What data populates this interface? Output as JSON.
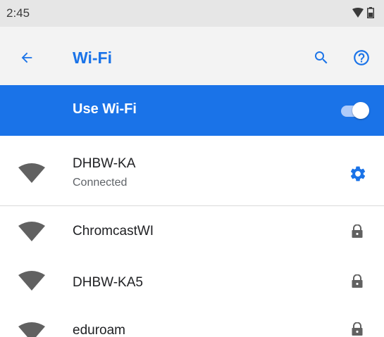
{
  "status_bar": {
    "time": "2:45",
    "icons": [
      "wifi-signal-icon",
      "battery-icon"
    ]
  },
  "app_bar": {
    "title": "Wi-Fi",
    "back_icon": "arrow-back-icon",
    "search_icon": "search-icon",
    "help_icon": "help-icon"
  },
  "master_switch": {
    "label": "Use Wi-Fi",
    "on": true
  },
  "colors": {
    "accent": "#1a73e8",
    "header_bg": "#f3f3f3",
    "status_bg": "#e6e6e6",
    "icon_grey": "#616161"
  },
  "networks": [
    {
      "name": "DHBW-KA",
      "status": "Connected",
      "trailing_icon": "gear-icon",
      "secured": false
    },
    {
      "name": "ChromcastWI",
      "status": "",
      "trailing_icon": "lock-icon",
      "secured": true
    },
    {
      "name": "DHBW-KA5",
      "status": "",
      "trailing_icon": "lock-icon",
      "secured": true
    },
    {
      "name": "eduroam",
      "status": "",
      "trailing_icon": "lock-icon",
      "secured": true
    }
  ]
}
